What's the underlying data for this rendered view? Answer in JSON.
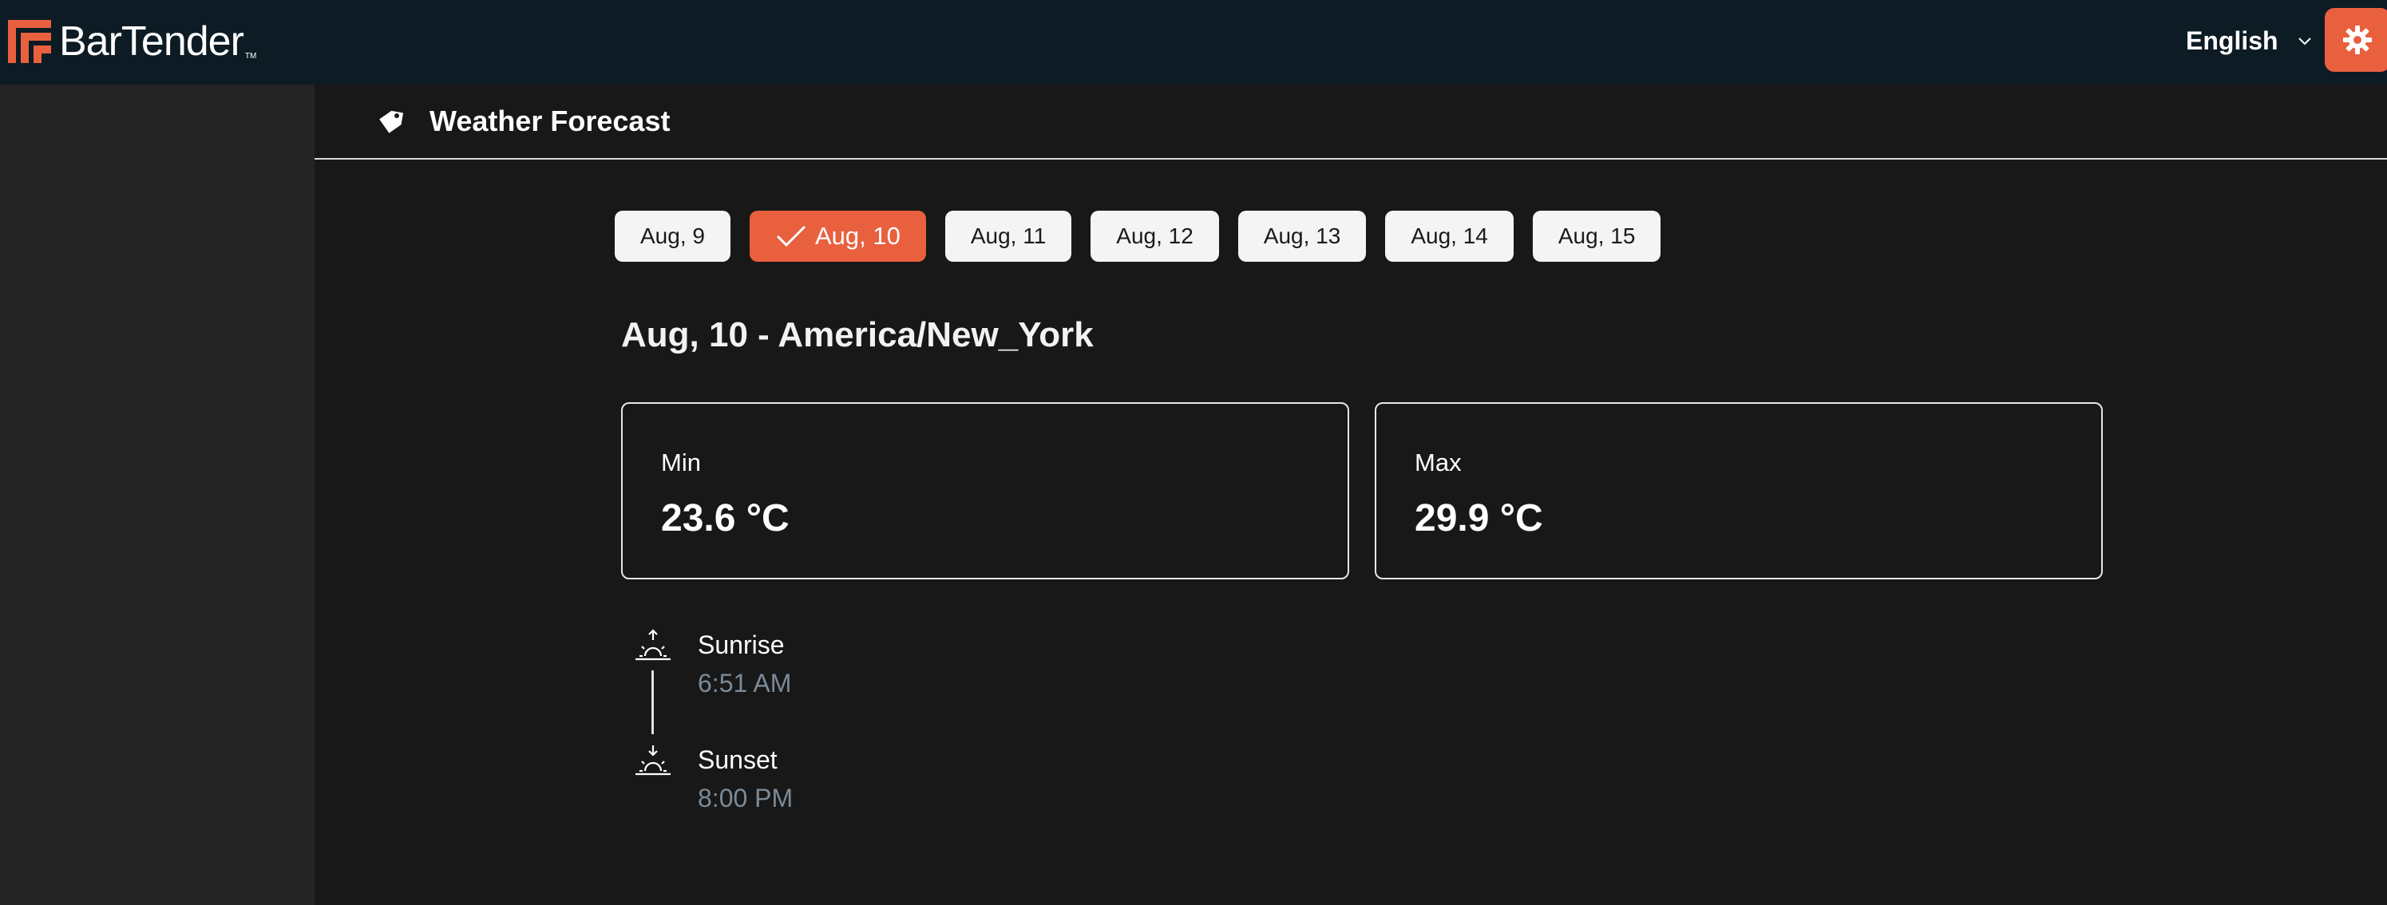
{
  "app": {
    "brand": "BarTender",
    "trademark": "TM",
    "accent_color": "#e9603f"
  },
  "header": {
    "language": "English",
    "settings_icon": "gear-icon"
  },
  "page": {
    "title": "Weather Forecast",
    "title_icon": "tag-icon"
  },
  "dates": {
    "selected_index": 1,
    "items": [
      {
        "label": "Aug, 9"
      },
      {
        "label": "Aug, 10"
      },
      {
        "label": "Aug, 11"
      },
      {
        "label": "Aug, 12"
      },
      {
        "label": "Aug, 13"
      },
      {
        "label": "Aug, 14"
      },
      {
        "label": "Aug, 15"
      }
    ]
  },
  "forecast": {
    "heading": "Aug, 10 - America/New_York",
    "min": {
      "label": "Min",
      "value": "23.6 °C"
    },
    "max": {
      "label": "Max",
      "value": "29.9 °C"
    },
    "sunrise": {
      "label": "Sunrise",
      "time": "6:51 AM",
      "icon": "sunrise-icon"
    },
    "sunset": {
      "label": "Sunset",
      "time": "8:00 PM",
      "icon": "sunset-icon"
    }
  }
}
